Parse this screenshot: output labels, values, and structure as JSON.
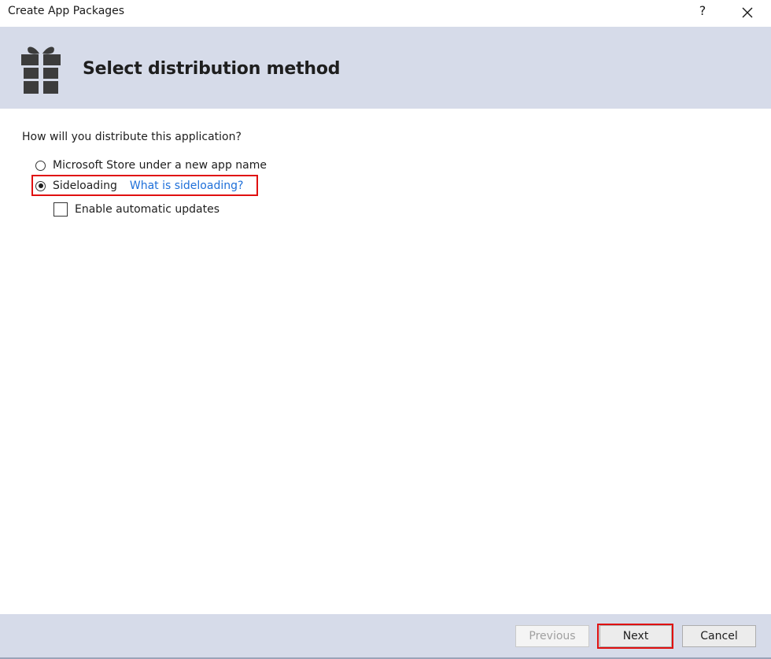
{
  "window": {
    "title": "Create App Packages",
    "help_label": "?",
    "close_icon": "close-icon"
  },
  "header": {
    "icon": "gift-icon",
    "title": "Select distribution method"
  },
  "content": {
    "question": "How will you distribute this application?",
    "options": [
      {
        "label": "Microsoft Store under a new app name",
        "selected": false
      },
      {
        "label": "Sideloading",
        "selected": true,
        "link": "What is sideloading?"
      }
    ],
    "auto_updates": {
      "label": "Enable automatic updates",
      "checked": false
    }
  },
  "footer": {
    "previous_label": "Previous",
    "next_label": "Next",
    "cancel_label": "Cancel"
  },
  "colors": {
    "band": "#d6dbe9",
    "link": "#1e6fd9",
    "highlight": "#e01010"
  }
}
